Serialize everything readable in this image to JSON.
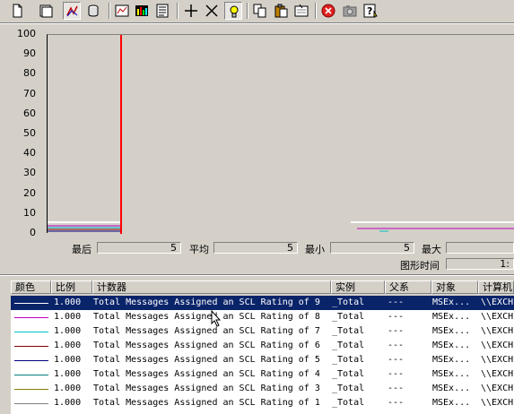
{
  "toolbar": {
    "buttons": [
      {
        "name": "new-counter-set-icon"
      },
      {
        "name": "clear-display-icon"
      },
      {
        "name": "view-current-activity-icon"
      },
      {
        "name": "view-log-data-icon"
      },
      {
        "name": "view-graph-icon"
      },
      {
        "name": "view-histogram-icon"
      },
      {
        "name": "view-report-icon"
      },
      {
        "name": "add-counter-icon"
      },
      {
        "name": "delete-counter-icon"
      },
      {
        "name": "highlight-icon"
      },
      {
        "name": "copy-properties-icon"
      },
      {
        "name": "paste-counter-list-icon"
      },
      {
        "name": "properties-icon"
      },
      {
        "name": "freeze-display-icon"
      },
      {
        "name": "update-data-icon"
      },
      {
        "name": "help-icon"
      }
    ]
  },
  "graph": {
    "y_ticks": [
      "100",
      "90",
      "80",
      "70",
      "60",
      "50",
      "40",
      "30",
      "20",
      "10",
      "0"
    ],
    "cursor_color": "#ff0000"
  },
  "stats": {
    "last_label": "最后",
    "last_value": "5",
    "avg_label": "平均",
    "avg_value": "5",
    "min_label": "最小",
    "min_value": "5",
    "max_label": "最大",
    "max_value": "",
    "duration_label": "图形时间",
    "duration_value": "1:"
  },
  "table": {
    "headers": {
      "color": "颜色",
      "scale": "比例",
      "counter": "计数器",
      "instance": "实例",
      "parent": "父系",
      "object": "对象",
      "computer": "计算机"
    },
    "rows": [
      {
        "color": "#0a246a",
        "scale": "1.000",
        "counter": "Total Messages Assigned an SCL Rating of 9",
        "instance": "_Total",
        "parent": "---",
        "object": "MSEx...",
        "computer": "\\\\EXCH",
        "selected": true
      },
      {
        "color": "#c000c0",
        "scale": "1.000",
        "counter": "Total Messages Assigned an SCL Rating of 8",
        "instance": "_Total",
        "parent": "---",
        "object": "MSEx...",
        "computer": "\\\\EXCH",
        "selected": false
      },
      {
        "color": "#00c0c0",
        "scale": "1.000",
        "counter": "Total Messages Assigned an SCL Rating of 7",
        "instance": "_Total",
        "parent": "---",
        "object": "MSEx...",
        "computer": "\\\\EXCH",
        "selected": false
      },
      {
        "color": "#800000",
        "scale": "1.000",
        "counter": "Total Messages Assigned an SCL Rating of 6",
        "instance": "_Total",
        "parent": "---",
        "object": "MSEx...",
        "computer": "\\\\EXCH",
        "selected": false
      },
      {
        "color": "#000080",
        "scale": "1.000",
        "counter": "Total Messages Assigned an SCL Rating of 5",
        "instance": "_Total",
        "parent": "---",
        "object": "MSEx...",
        "computer": "\\\\EXCH",
        "selected": false
      },
      {
        "color": "#008080",
        "scale": "1.000",
        "counter": "Total Messages Assigned an SCL Rating of 4",
        "instance": "_Total",
        "parent": "---",
        "object": "MSEx...",
        "computer": "\\\\EXCH",
        "selected": false
      },
      {
        "color": "#808000",
        "scale": "1.000",
        "counter": "Total Messages Assigned an SCL Rating of 3",
        "instance": "_Total",
        "parent": "---",
        "object": "MSEx...",
        "computer": "\\\\EXCH",
        "selected": false
      },
      {
        "color": "#808080",
        "scale": "1.000",
        "counter": "Total Messages Assigned an SCL Rating of 1",
        "instance": "_Total",
        "parent": "---",
        "object": "MSEx...",
        "computer": "\\\\EXCH",
        "selected": false
      }
    ]
  }
}
